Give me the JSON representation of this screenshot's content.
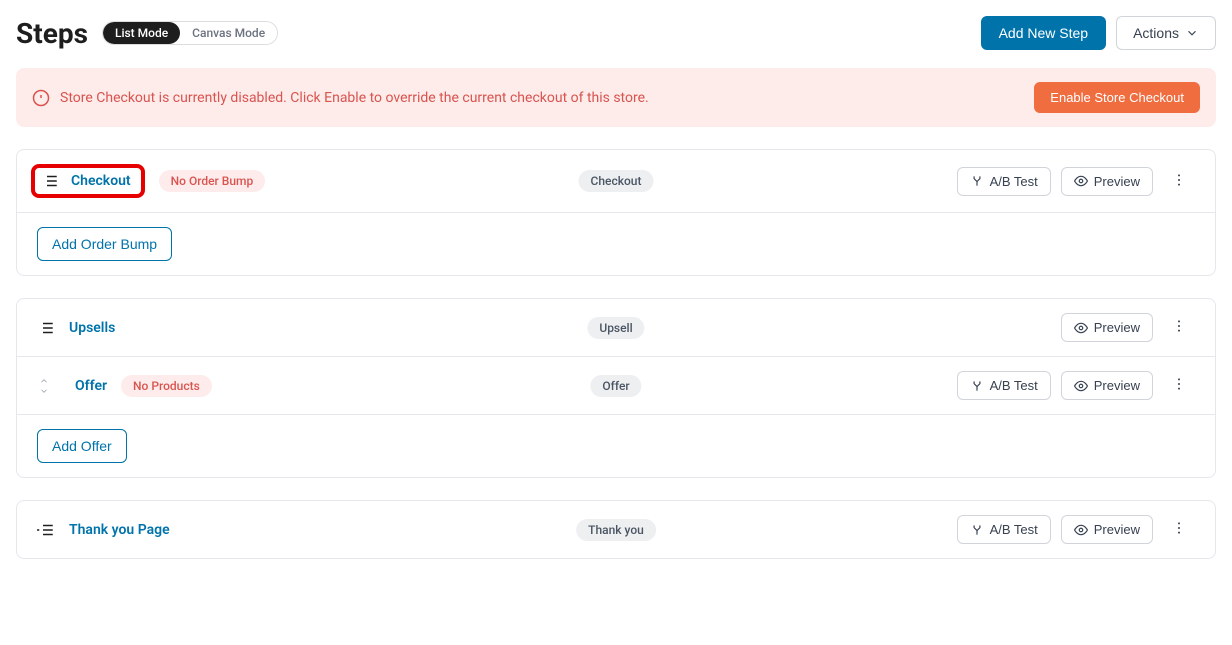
{
  "header": {
    "title": "Steps",
    "mode_list": "List Mode",
    "mode_canvas": "Canvas Mode",
    "add_new_step": "Add New Step",
    "actions": "Actions"
  },
  "notice": {
    "message": "Store Checkout is currently disabled. Click Enable to override the current checkout of this store.",
    "enable_button": "Enable Store Checkout"
  },
  "steps": {
    "checkout": {
      "title": "Checkout",
      "badge": "No Order Bump",
      "type_badge": "Checkout",
      "ab_test": "A/B Test",
      "preview": "Preview",
      "add_bump": "Add Order Bump"
    },
    "upsells": {
      "title": "Upsells",
      "type_badge": "Upsell",
      "preview": "Preview",
      "offer": {
        "title": "Offer",
        "badge": "No Products",
        "type_badge": "Offer",
        "ab_test": "A/B Test",
        "preview": "Preview"
      },
      "add_offer": "Add Offer"
    },
    "thankyou": {
      "title": "Thank you Page",
      "type_badge": "Thank you",
      "ab_test": "A/B Test",
      "preview": "Preview"
    }
  }
}
